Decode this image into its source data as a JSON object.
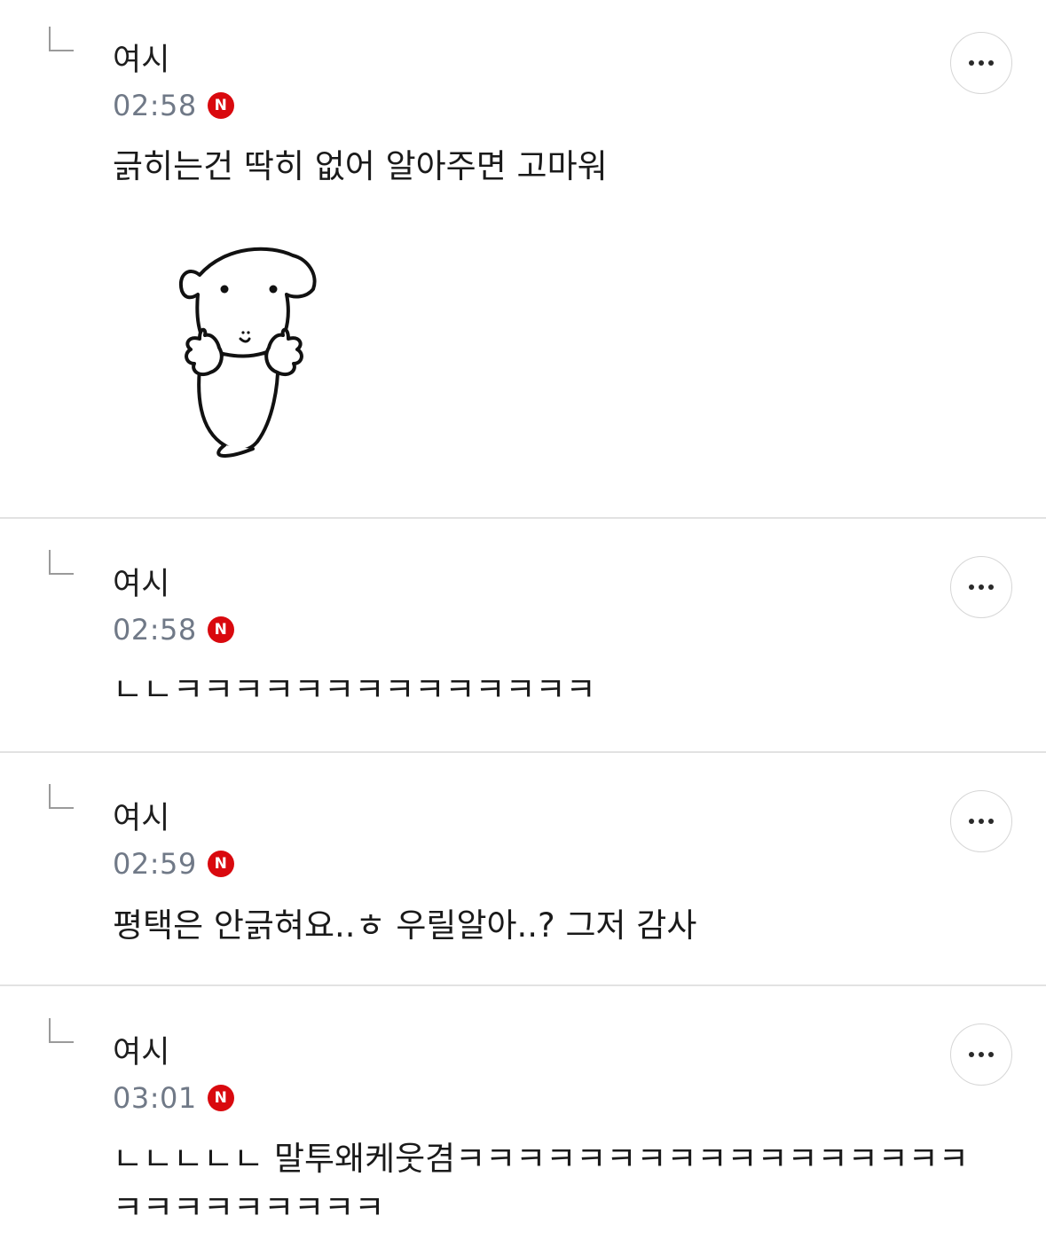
{
  "comments": [
    {
      "author": "여시",
      "time": "02:58",
      "badge": "N",
      "text": "긁히는건 딱히 없어 알아주면 고마워",
      "has_sticker": true,
      "sticker_icon": "puppy-sticker-icon"
    },
    {
      "author": "여시",
      "time": "02:58",
      "badge": "N",
      "text": "ㄴㄴㅋㅋㅋㅋㅋㅋㅋㅋㅋㅋㅋㅋㅋㅋ"
    },
    {
      "author": "여시",
      "time": "02:59",
      "badge": "N",
      "text": "평택은 안긁혀요..ㅎ 우릴알아..? 그저 감사"
    },
    {
      "author": "여시",
      "time": "03:01",
      "badge": "N",
      "text": "ㄴㄴㄴㄴㄴ 말투왜케웃겸ㅋㅋㅋㅋㅋㅋㅋㅋㅋㅋㅋㅋㅋㅋㅋㅋㅋㅋㅋㅋㅋㅋㅋㅋㅋㅋ"
    }
  ],
  "icons": {
    "reply": "reply-arrow-icon",
    "more": "more-options-icon",
    "new_badge": "new-badge-icon"
  },
  "colors": {
    "badge": "#d9090e",
    "time": "#707987",
    "divider": "#e2e2e2"
  }
}
